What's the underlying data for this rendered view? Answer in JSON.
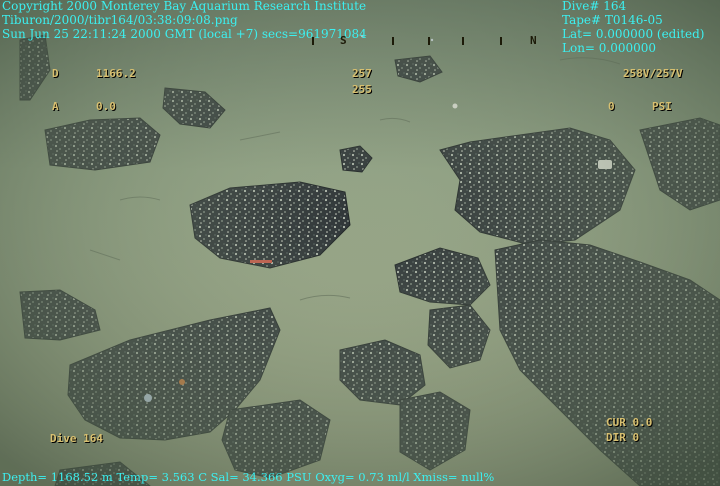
{
  "header_left": {
    "copyright": "Copyright 2000 Monterey Bay Aquarium Research Institute",
    "file_name": "Tiburon/2000/tibr164/03:38:09:08.png",
    "datetime": "Sun Jun 25 22:11:24 2000 GMT (local +7)  secs=961971084"
  },
  "header_right": {
    "dive": "Dive# 164",
    "tape": "Tape# T0146-05",
    "lat": "Lat= 0.000000 (edited)",
    "lon": "Lon= 0.000000"
  },
  "compass_strip": {
    "marks": [
      "S",
      "N"
    ]
  },
  "osd": {
    "depth_label": "D",
    "depth_value": "1166.2",
    "heading_1": "257",
    "heading_2": "255",
    "heading_pair": "258V/257V",
    "alt_label": "A",
    "alt_value": "0.0",
    "psi_value": "0",
    "psi_label": "PSI",
    "dive_label": "Dive 164",
    "cur": "CUR 0.0",
    "dir": "DIR 0"
  },
  "footer": {
    "telemetry": "Depth= 1168.52 m  Temp= 3.563 C  Sal= 34.366 PSU  Oxyg= 0.73 ml/l  Xmiss= null%"
  },
  "colors": {
    "overlay_text": "#3cf0f0",
    "osd_text": "#d8c070",
    "sediment": "#8a9a7e",
    "rock": "#2e3436"
  }
}
